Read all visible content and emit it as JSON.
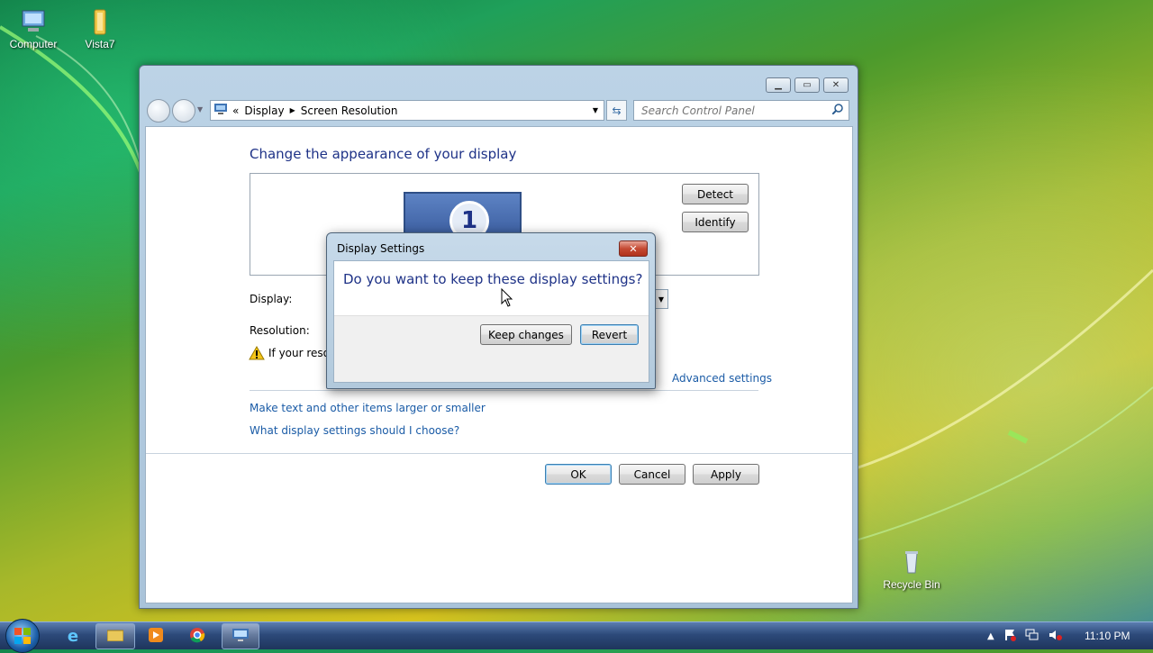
{
  "desktop": {
    "icons": [
      {
        "label": "Computer"
      },
      {
        "label": "Vista7"
      },
      {
        "label": "Recycle Bin"
      }
    ]
  },
  "window": {
    "breadcrumb": [
      "«",
      "Display",
      "Screen Resolution"
    ],
    "search_placeholder": "Search Control Panel",
    "heading": "Change the appearance of your display",
    "monitor_number": "1",
    "detect_label": "Detect",
    "identify_label": "Identify",
    "display_label": "Display:",
    "resolution_label": "Resolution:",
    "warning_text": "If your resol",
    "advanced_link": "Advanced settings",
    "link_text_size": "Make text and other items larger or smaller",
    "link_help": "What display settings should I choose?",
    "ok_label": "OK",
    "cancel_label": "Cancel",
    "apply_label": "Apply"
  },
  "dialog": {
    "title": "Display Settings",
    "question": "Do you want to keep these display settings?",
    "keep_label": "Keep changes",
    "revert_label": "Revert",
    "close_glyph": "✕"
  },
  "taskbar": {
    "clock": "11:10 PM",
    "tray_icons": [
      "show-hidden-arrow-icon",
      "action-center-icon",
      "network-icon",
      "volume-muted-icon"
    ]
  },
  "colors": {
    "heading_blue": "#1e3287",
    "link_blue": "#1a5ba6",
    "close_red": "#c54a33"
  }
}
